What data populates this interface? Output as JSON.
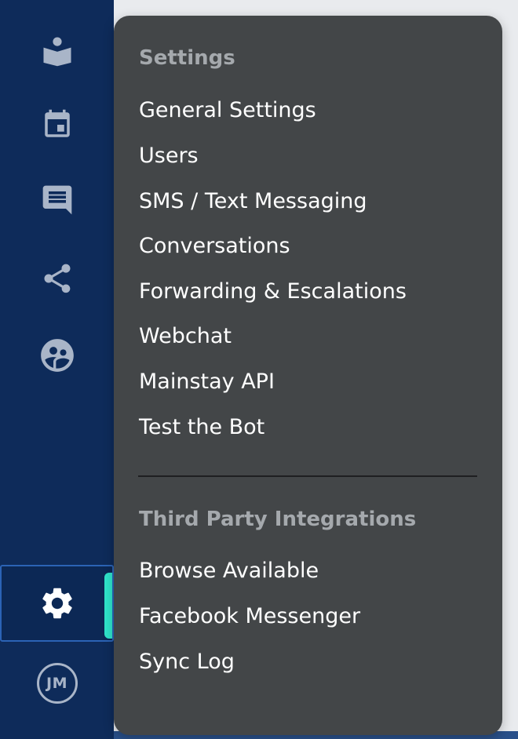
{
  "sidebar": {
    "icons": [
      {
        "name": "book-reader-icon"
      },
      {
        "name": "calendar-icon"
      },
      {
        "name": "message-icon"
      },
      {
        "name": "share-icon"
      },
      {
        "name": "people-circle-icon"
      },
      {
        "name": "gear-icon",
        "active": true
      }
    ],
    "avatar_initials": "JM",
    "accent_color": "#2fe3c9",
    "background_color": "#0e2b5a"
  },
  "menu": {
    "settings_heading": "Settings",
    "settings_items": [
      {
        "label": "General Settings"
      },
      {
        "label": "Users"
      },
      {
        "label": "SMS / Text Messaging"
      },
      {
        "label": "Conversations"
      },
      {
        "label": "Forwarding & Escalations"
      },
      {
        "label": "Webchat"
      },
      {
        "label": "Mainstay API"
      },
      {
        "label": "Test the Bot"
      }
    ],
    "integrations_heading": "Third Party Integrations",
    "integration_items": [
      {
        "label": "Browse Available"
      },
      {
        "label": "Facebook Messenger"
      },
      {
        "label": "Sync Log"
      }
    ],
    "background_color": "#434648"
  }
}
